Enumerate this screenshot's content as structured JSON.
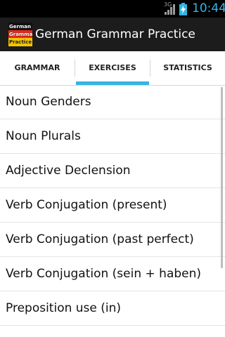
{
  "status_bar": {
    "network": "3G",
    "time": "10:44"
  },
  "action_bar": {
    "icon": {
      "name": "app-logo",
      "lines": [
        "German",
        "Grammar",
        "Practice"
      ]
    },
    "title": "German Grammar Practice"
  },
  "tabs": [
    {
      "label": "GRAMMAR"
    },
    {
      "label": "EXERCISES",
      "selected": true
    },
    {
      "label": "STATISTICS"
    }
  ],
  "exercises": [
    {
      "label": "Noun Genders"
    },
    {
      "label": "Noun Plurals"
    },
    {
      "label": "Adjective Declension"
    },
    {
      "label": "Verb Conjugation (present)"
    },
    {
      "label": "Verb Conjugation (past perfect)"
    },
    {
      "label": "Verb Conjugation (sein + haben)"
    },
    {
      "label": "Preposition use (in)"
    }
  ],
  "colors": {
    "accent": "#33b5e5",
    "action_bar": "#1c1c1c",
    "status_bar": "#000000"
  },
  "icons": [
    "signal-icon",
    "battery-charging-icon",
    "app-logo-icon"
  ]
}
